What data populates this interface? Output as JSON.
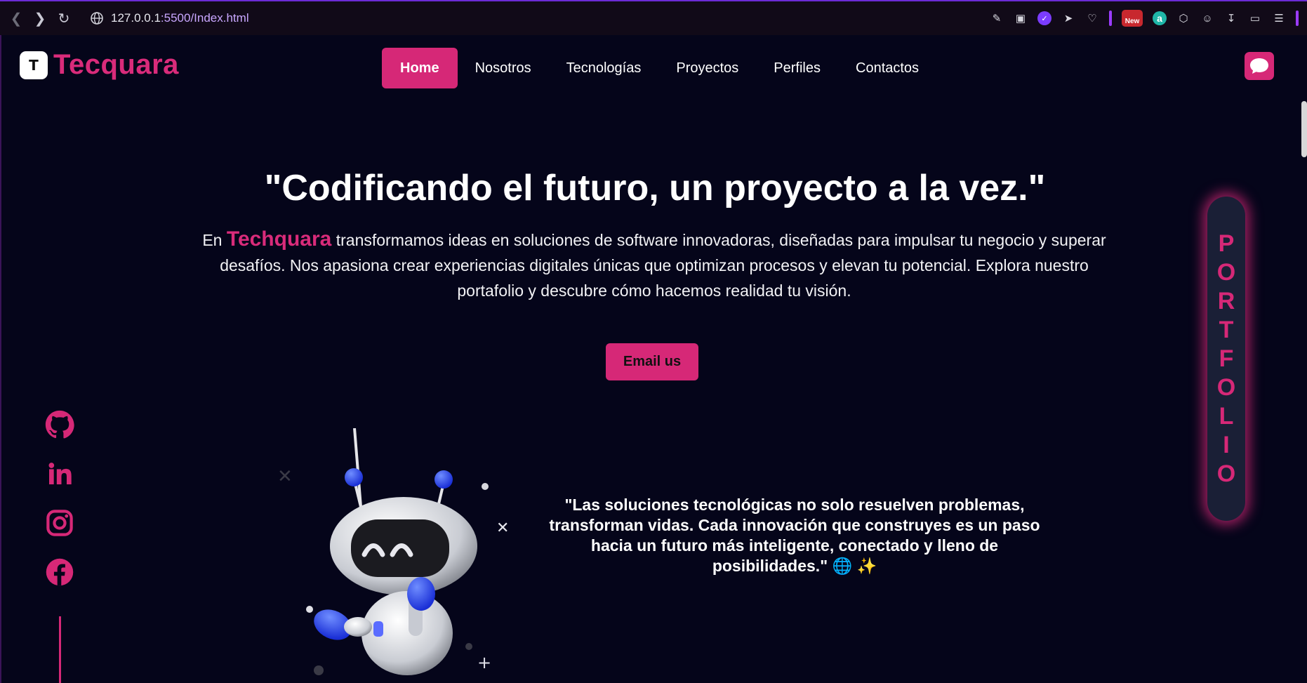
{
  "browser": {
    "url_host": "127.0.0.1",
    "url_rest": ":5500/Index.html",
    "new_badge": "New",
    "ext_letter": "a"
  },
  "header": {
    "logo_mark": "T",
    "logo_text": "Tecquara",
    "nav": [
      {
        "label": "Home"
      },
      {
        "label": "Nosotros"
      },
      {
        "label": "Tecnologías"
      },
      {
        "label": "Proyectos"
      },
      {
        "label": "Perfiles"
      },
      {
        "label": "Contactos"
      }
    ]
  },
  "hero": {
    "title": "\"Codificando el futuro, un proyecto a la vez.\"",
    "text_pre": "En ",
    "brand": "Techquara",
    "text_post": " transformamos ideas en soluciones de software innovadoras, diseñadas para impulsar tu negocio y superar desafíos. Nos apasiona crear experiencias digitales únicas que optimizan procesos y elevan tu potencial. Explora nuestro portafolio y descubre cómo hacemos realidad tu visión.",
    "cta": "Email us"
  },
  "quote": "\"Las soluciones tecnológicas no solo resuelven problemas, transforman vidas. Cada innovación que construyes es un paso hacia un futuro más inteligente, conectado y lleno de posibilidades.\" 🌐 ✨",
  "portfolio_letters": [
    "P",
    "O",
    "R",
    "T",
    "F",
    "O",
    "L",
    "I",
    "O"
  ],
  "socials": [
    "github-icon",
    "linkedin-icon",
    "instagram-icon",
    "facebook-icon"
  ],
  "colors": {
    "accent": "#d62877",
    "background": "#05051a"
  }
}
